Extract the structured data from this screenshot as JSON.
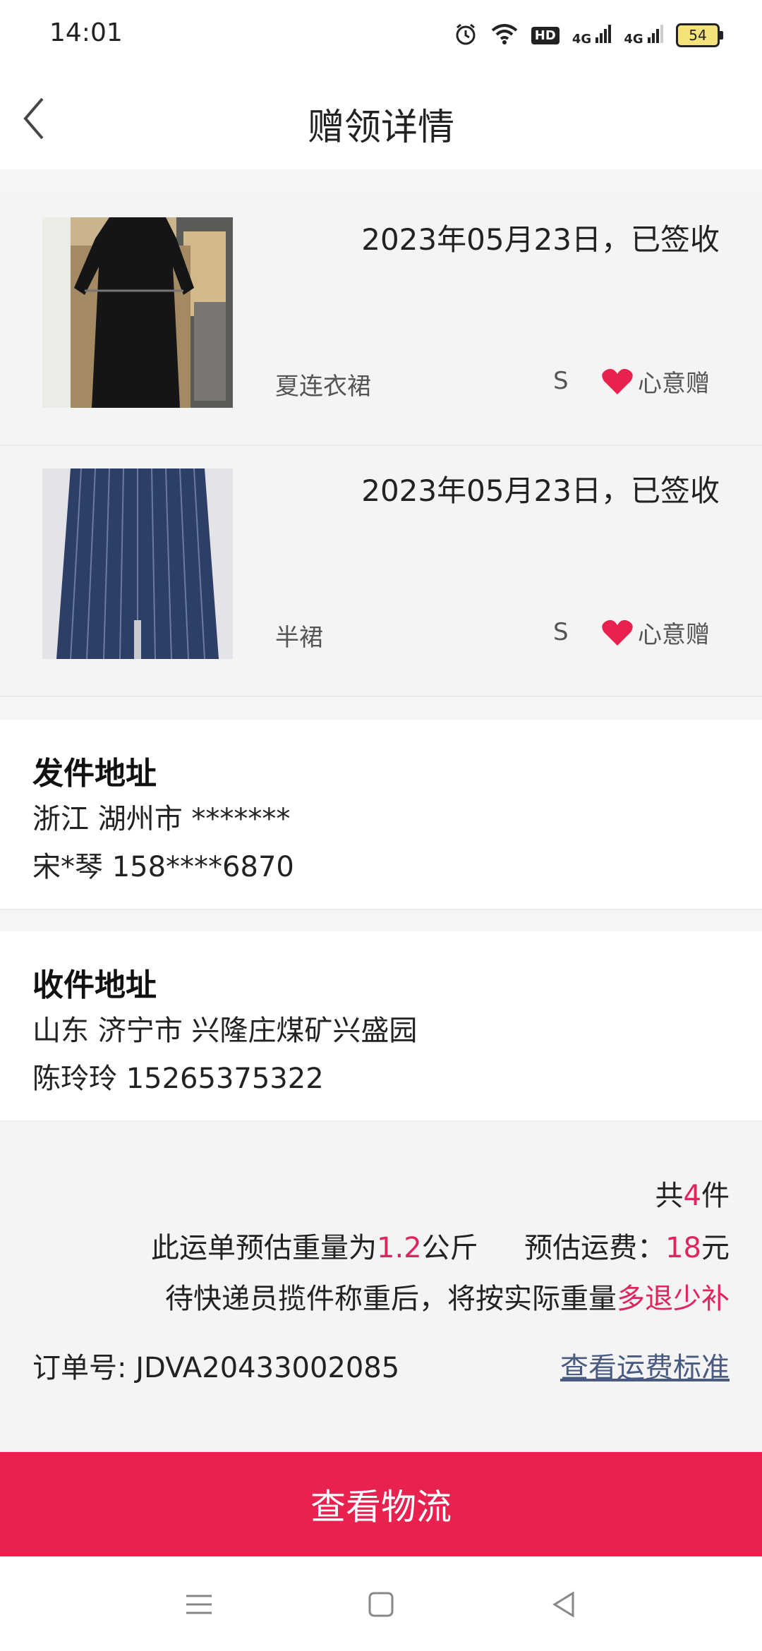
{
  "status_bar": {
    "time": "14:01",
    "hd_badge": "HD",
    "signal1": "4G",
    "signal2": "4G",
    "battery": "54"
  },
  "header": {
    "title": "赠领详情"
  },
  "items": [
    {
      "date_status": "2023年05月23日，已签收",
      "name": "夏连衣裙",
      "size": "S",
      "tag": "心意赠"
    },
    {
      "date_status": "2023年05月23日，已签收",
      "name": "半裙",
      "size": "S",
      "tag": "心意赠"
    }
  ],
  "sender": {
    "title": "发件地址",
    "address": "浙江 湖州市 *******",
    "contact": "宋*琴 158****6870"
  },
  "receiver": {
    "title": "收件地址",
    "address": "山东 济宁市 兴隆庄煤矿兴盛园",
    "contact": "陈玲玲 15265375322"
  },
  "summary": {
    "count_prefix": "共",
    "count": "4",
    "count_suffix": "件",
    "weight_prefix": "此运单预估重量为",
    "weight": "1.2",
    "weight_unit": "公斤",
    "fee_prefix": "预估运费：",
    "fee": "18",
    "fee_unit": "元",
    "note_prefix": "待快递员揽件称重后，将按实际重量",
    "note_highlight": "多退少补",
    "order_label": "订单号:",
    "order_number": "JDVA20433002085",
    "fee_link": "查看运费标准"
  },
  "cta": {
    "label": "查看物流"
  },
  "colors": {
    "accent": "#e8214f",
    "highlight_text": "#e0245e",
    "link": "#4a5b82"
  }
}
